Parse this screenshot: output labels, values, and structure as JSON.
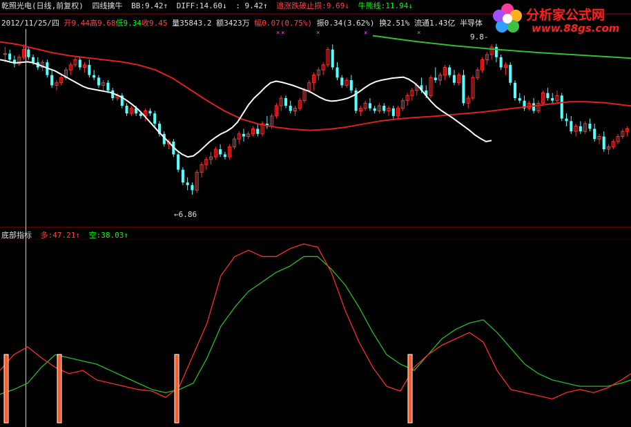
{
  "header": {
    "stock_name": "乾照光电",
    "period": "(日线,前复权)",
    "indicator_name": "四线擒牛",
    "bb_label": "BB:",
    "bb_value": "9.42↑",
    "diff_label": "DIFF:",
    "diff_value": "14.60↓",
    "colon_value": ": 9.42↑",
    "stop_label": "追涨跌破止损:",
    "stop_value": "9.69↓",
    "bull_label": "牛熊线:",
    "bull_value": "11.94↓"
  },
  "info": {
    "date": "2012/11/25/四",
    "open_label": "开",
    "open": "9.44",
    "high_label": "高",
    "high": "9.68",
    "low_label": "低",
    "low": "9.34",
    "close_label": "收",
    "close": "9.45",
    "volume_label": "量",
    "volume": "35843.2",
    "amount_label": "额",
    "amount": "3423万",
    "range_label": "幅",
    "range": "0.07(0.75%)",
    "amplitude_label": "振",
    "amplitude": "0.34(3.62%)",
    "turnover_label": "换",
    "turnover": "2.51%",
    "float_label": "流通",
    "float": "1.43亿",
    "sector": "半导体"
  },
  "indicator": {
    "name": "底部指标",
    "long_label": "多:",
    "long_value": "47.21↑",
    "short_label": "空:",
    "short_value": "38.03↑"
  },
  "logo": {
    "brand": "分析家公式网",
    "site": "www.88gs.com"
  },
  "annotations": {
    "high_label": "9.8-",
    "low_label": "6.86"
  },
  "colors": {
    "up": "#ff3232",
    "down": "#54ffff",
    "ma_white": "#ffffff",
    "ma_red": "#e02020",
    "bull_line": "#30c030",
    "ind_long": "#ff2a2a",
    "ind_short": "#20c020",
    "bottom_bar": "#ff5a28",
    "grid": "#a00000",
    "marker": "#ff40ff"
  },
  "chart_data": [
    {
      "type": "candlestick",
      "title": "乾照光电 (日线,前复权)",
      "ylim": [
        6.4,
        10.1
      ],
      "candles": [
        [
          9.6,
          9.75,
          9.45,
          9.62
        ],
        [
          9.62,
          9.7,
          9.45,
          9.5
        ],
        [
          9.5,
          9.58,
          9.35,
          9.42
        ],
        [
          9.42,
          9.6,
          9.38,
          9.55
        ],
        [
          9.55,
          9.8,
          9.5,
          9.7
        ],
        [
          9.7,
          9.75,
          9.5,
          9.55
        ],
        [
          9.55,
          9.6,
          9.4,
          9.45
        ],
        [
          9.45,
          9.55,
          9.3,
          9.35
        ],
        [
          9.35,
          9.5,
          9.28,
          9.45
        ],
        [
          9.45,
          9.5,
          9.15,
          9.2
        ],
        [
          9.2,
          9.3,
          8.95,
          9.0
        ],
        [
          9.0,
          9.1,
          8.9,
          9.05
        ],
        [
          9.05,
          9.2,
          9.0,
          9.15
        ],
        [
          9.15,
          9.35,
          9.1,
          9.3
        ],
        [
          9.3,
          9.45,
          9.2,
          9.4
        ],
        [
          9.4,
          9.55,
          9.35,
          9.5
        ],
        [
          9.5,
          9.55,
          9.3,
          9.35
        ],
        [
          9.35,
          9.45,
          9.25,
          9.4
        ],
        [
          9.4,
          9.5,
          9.15,
          9.2
        ],
        [
          9.2,
          9.3,
          9.1,
          9.15
        ],
        [
          9.15,
          9.2,
          8.95,
          9.0
        ],
        [
          9.0,
          9.1,
          8.9,
          9.05
        ],
        [
          9.05,
          9.1,
          8.85,
          8.9
        ],
        [
          8.9,
          8.95,
          8.7,
          8.75
        ],
        [
          8.75,
          8.85,
          8.7,
          8.8
        ],
        [
          8.8,
          8.85,
          8.55,
          8.6
        ],
        [
          8.6,
          8.65,
          8.4,
          8.45
        ],
        [
          8.45,
          8.6,
          8.4,
          8.55
        ],
        [
          8.55,
          8.6,
          8.4,
          8.45
        ],
        [
          8.45,
          8.5,
          8.35,
          8.4
        ],
        [
          8.4,
          8.55,
          8.3,
          8.5
        ],
        [
          8.5,
          8.55,
          8.4,
          8.45
        ],
        [
          8.45,
          8.5,
          8.2,
          8.25
        ],
        [
          8.25,
          8.3,
          8.0,
          8.05
        ],
        [
          8.05,
          8.1,
          7.8,
          7.85
        ],
        [
          7.85,
          7.95,
          7.75,
          7.9
        ],
        [
          7.9,
          7.95,
          7.6,
          7.65
        ],
        [
          7.65,
          7.7,
          7.3,
          7.35
        ],
        [
          7.35,
          7.4,
          7.05,
          7.1
        ],
        [
          7.1,
          7.2,
          6.95,
          7.05
        ],
        [
          7.05,
          7.1,
          6.86,
          6.95
        ],
        [
          6.95,
          7.35,
          6.9,
          7.3
        ],
        [
          7.3,
          7.5,
          7.2,
          7.45
        ],
        [
          7.45,
          7.6,
          7.35,
          7.55
        ],
        [
          7.55,
          7.7,
          7.45,
          7.6
        ],
        [
          7.6,
          7.8,
          7.55,
          7.75
        ],
        [
          7.75,
          7.85,
          7.6,
          7.65
        ],
        [
          7.65,
          7.7,
          7.55,
          7.6
        ],
        [
          7.6,
          7.85,
          7.55,
          7.8
        ],
        [
          7.8,
          8.0,
          7.75,
          7.95
        ],
        [
          7.95,
          8.1,
          7.85,
          8.05
        ],
        [
          8.05,
          8.15,
          7.9,
          8.0
        ],
        [
          8.0,
          8.1,
          7.95,
          8.05
        ],
        [
          8.05,
          8.2,
          8.0,
          8.15
        ],
        [
          8.15,
          8.25,
          8.0,
          8.05
        ],
        [
          8.05,
          8.3,
          8.0,
          8.25
        ],
        [
          8.25,
          8.4,
          8.15,
          8.2
        ],
        [
          8.2,
          8.45,
          8.15,
          8.4
        ],
        [
          8.4,
          8.65,
          8.35,
          8.6
        ],
        [
          8.6,
          8.8,
          8.5,
          8.75
        ],
        [
          8.75,
          8.8,
          8.55,
          8.6
        ],
        [
          8.6,
          8.7,
          8.45,
          8.5
        ],
        [
          8.5,
          8.6,
          8.4,
          8.55
        ],
        [
          8.55,
          8.75,
          8.5,
          8.7
        ],
        [
          8.7,
          8.95,
          8.65,
          8.9
        ],
        [
          8.9,
          9.1,
          8.85,
          9.05
        ],
        [
          9.05,
          9.25,
          8.9,
          9.2
        ],
        [
          9.2,
          9.35,
          9.1,
          9.3
        ],
        [
          9.3,
          9.45,
          9.2,
          9.4
        ],
        [
          9.4,
          9.75,
          9.35,
          9.7
        ],
        [
          9.7,
          9.8,
          9.3,
          9.35
        ],
        [
          9.35,
          9.45,
          9.1,
          9.15
        ],
        [
          9.15,
          9.2,
          8.95,
          9.0
        ],
        [
          9.0,
          9.15,
          8.95,
          9.1
        ],
        [
          9.1,
          9.2,
          8.85,
          8.9
        ],
        [
          8.9,
          8.95,
          8.45,
          8.5
        ],
        [
          8.5,
          8.6,
          8.4,
          8.55
        ],
        [
          8.55,
          8.7,
          8.5,
          8.65
        ],
        [
          8.65,
          8.75,
          8.5,
          8.55
        ],
        [
          8.55,
          8.6,
          8.45,
          8.5
        ],
        [
          8.5,
          8.65,
          8.45,
          8.6
        ],
        [
          8.6,
          8.65,
          8.45,
          8.5
        ],
        [
          8.5,
          8.6,
          8.4,
          8.55
        ],
        [
          8.55,
          8.6,
          8.35,
          8.4
        ],
        [
          8.4,
          8.6,
          8.35,
          8.55
        ],
        [
          8.55,
          8.75,
          8.5,
          8.7
        ],
        [
          8.7,
          8.85,
          8.6,
          8.8
        ],
        [
          8.8,
          8.95,
          8.7,
          8.9
        ],
        [
          8.9,
          9.05,
          8.8,
          9.0
        ],
        [
          9.0,
          9.15,
          8.85,
          8.9
        ],
        [
          8.9,
          9.0,
          8.75,
          8.8
        ],
        [
          8.8,
          9.2,
          8.75,
          9.15
        ],
        [
          9.15,
          9.35,
          9.05,
          9.1
        ],
        [
          9.1,
          9.25,
          9.0,
          9.2
        ],
        [
          9.2,
          9.4,
          9.1,
          9.35
        ],
        [
          9.35,
          9.4,
          9.15,
          9.2
        ],
        [
          9.2,
          9.3,
          9.0,
          9.05
        ],
        [
          9.05,
          9.25,
          9.0,
          9.2
        ],
        [
          9.2,
          9.3,
          8.6,
          8.65
        ],
        [
          8.65,
          8.8,
          8.55,
          8.75
        ],
        [
          8.75,
          9.2,
          8.7,
          9.15
        ],
        [
          9.15,
          9.35,
          9.1,
          9.3
        ],
        [
          9.3,
          9.55,
          9.25,
          9.5
        ],
        [
          9.5,
          9.65,
          9.4,
          9.6
        ],
        [
          9.6,
          9.8,
          9.5,
          9.75
        ],
        [
          9.75,
          9.81,
          9.45,
          9.55
        ],
        [
          9.55,
          9.6,
          9.3,
          9.35
        ],
        [
          9.35,
          9.45,
          9.2,
          9.4
        ],
        [
          9.4,
          9.45,
          9.0,
          9.05
        ],
        [
          9.05,
          9.1,
          8.7,
          8.75
        ],
        [
          8.75,
          8.85,
          8.65,
          8.7
        ],
        [
          8.7,
          8.8,
          8.5,
          8.55
        ],
        [
          8.55,
          8.7,
          8.5,
          8.65
        ],
        [
          8.65,
          8.75,
          8.45,
          8.5
        ],
        [
          8.5,
          8.7,
          8.45,
          8.65
        ],
        [
          8.65,
          8.9,
          8.6,
          8.85
        ],
        [
          8.85,
          8.95,
          8.7,
          8.75
        ],
        [
          8.75,
          8.85,
          8.65,
          8.7
        ],
        [
          8.7,
          8.9,
          8.65,
          8.8
        ],
        [
          8.8,
          8.85,
          8.3,
          8.35
        ],
        [
          8.35,
          8.45,
          8.2,
          8.3
        ],
        [
          8.3,
          8.4,
          8.05,
          8.1
        ],
        [
          8.1,
          8.25,
          8.0,
          8.2
        ],
        [
          8.2,
          8.3,
          8.05,
          8.1
        ],
        [
          8.1,
          8.3,
          8.05,
          8.25
        ],
        [
          8.25,
          8.35,
          8.1,
          8.15
        ],
        [
          8.15,
          8.25,
          7.9,
          7.95
        ],
        [
          7.95,
          8.05,
          7.85,
          8.0
        ],
        [
          8.0,
          8.1,
          7.7,
          7.75
        ],
        [
          7.75,
          7.85,
          7.65,
          7.8
        ],
        [
          7.8,
          7.95,
          7.75,
          7.9
        ],
        [
          7.9,
          8.05,
          7.85,
          8.0
        ],
        [
          8.0,
          8.15,
          7.95,
          8.1
        ],
        [
          8.1,
          8.2,
          8.0,
          8.15
        ]
      ],
      "ma_white": [
        9.5,
        9.48,
        9.45,
        9.44,
        9.45,
        9.46,
        9.44,
        9.4,
        9.36,
        9.32,
        9.28,
        9.22,
        9.16,
        9.1,
        9.04,
        8.98,
        8.94,
        8.92,
        8.9,
        8.88,
        8.86,
        8.82,
        8.77,
        8.7,
        8.62,
        8.53,
        8.42,
        8.3,
        8.18,
        8.06,
        7.95,
        7.84,
        7.73,
        7.65,
        7.6,
        7.62,
        7.7,
        7.8,
        7.9,
        7.98,
        8.05,
        8.1,
        8.17,
        8.28,
        8.45,
        8.62,
        8.75,
        8.85,
        8.96,
        9.05,
        9.08,
        9.06,
        9.03,
        9.0,
        8.96,
        8.92,
        8.88,
        8.82,
        8.76,
        8.71,
        8.69,
        8.7,
        8.72,
        8.75,
        8.8,
        8.87,
        8.95,
        9.02,
        9.07,
        9.1,
        9.12,
        9.14,
        9.15,
        9.16,
        9.12,
        9.05,
        8.95,
        8.82,
        8.69,
        8.58,
        8.5,
        8.43,
        8.36,
        8.28,
        8.2,
        8.12,
        8.03,
        7.96,
        7.9,
        7.92
      ],
      "ma_white_x": [
        0,
        8,
        16,
        24,
        32,
        40,
        48,
        56,
        64,
        72,
        80,
        88,
        96,
        104,
        112,
        120,
        128,
        136,
        144,
        152,
        160,
        168,
        176,
        184,
        192,
        200,
        208,
        216,
        224,
        232,
        240,
        248,
        256,
        264,
        272,
        280,
        288,
        296,
        304,
        312,
        320,
        328,
        336,
        344,
        352,
        360,
        368,
        376,
        384,
        392,
        400,
        408,
        416,
        424,
        432,
        440,
        448,
        456,
        464,
        472,
        480,
        488,
        496,
        504,
        512,
        520,
        528,
        536,
        544,
        552,
        560,
        568,
        576,
        584,
        592,
        600,
        608,
        616,
        624,
        632,
        640,
        648,
        656,
        664,
        672,
        680,
        688,
        696,
        704,
        712
      ],
      "ma_red": [
        9.85,
        9.8,
        9.72,
        9.64,
        9.58,
        9.54,
        9.5,
        9.46,
        9.4,
        9.3,
        9.14,
        8.92,
        8.7,
        8.5,
        8.34,
        8.24,
        8.18,
        8.14,
        8.12,
        8.14,
        8.18,
        8.24,
        8.3,
        8.34,
        8.37,
        8.39,
        8.42,
        8.45,
        8.48,
        8.52,
        8.56,
        8.6,
        8.64,
        8.68,
        8.68,
        8.66,
        8.62,
        8.58,
        8.55,
        8.53
      ],
      "ma_red_x": [
        0,
        25,
        50,
        75,
        100,
        125,
        150,
        175,
        200,
        225,
        250,
        275,
        300,
        325,
        350,
        375,
        400,
        425,
        450,
        475,
        500,
        525,
        550,
        575,
        600,
        625,
        650,
        675,
        700,
        725,
        750,
        775,
        800,
        825,
        850,
        875,
        900,
        925,
        950,
        1000
      ],
      "bull_line_x": [
        540,
        600,
        660,
        720,
        780,
        840,
        914
      ],
      "bull_line": [
        9.97,
        9.86,
        9.77,
        9.7,
        9.64,
        9.59,
        9.53
      ]
    },
    {
      "type": "line",
      "title": "底部指标",
      "ylim": [
        0,
        100
      ],
      "x": [
        0,
        20,
        40,
        60,
        80,
        100,
        120,
        140,
        160,
        180,
        200,
        220,
        240,
        260,
        280,
        300,
        320,
        340,
        360,
        380,
        400,
        420,
        440,
        460,
        480,
        500,
        520,
        540,
        560,
        580,
        600,
        620,
        640,
        660,
        680,
        700,
        720,
        740,
        760,
        780,
        800,
        820,
        840,
        860,
        880,
        900,
        914
      ],
      "series": [
        {
          "name": "多",
          "values": [
            20,
            30,
            35,
            28,
            22,
            18,
            20,
            14,
            12,
            10,
            8,
            7,
            3,
            10,
            30,
            50,
            80,
            92,
            96,
            92,
            92,
            97,
            100,
            98,
            82,
            58,
            38,
            22,
            10,
            7,
            22,
            30,
            36,
            40,
            44,
            38,
            20,
            8,
            6,
            4,
            2,
            6,
            8,
            6,
            9,
            14,
            18
          ]
        },
        {
          "name": "空",
          "values": [
            5,
            8,
            12,
            22,
            30,
            28,
            26,
            24,
            20,
            16,
            12,
            8,
            6,
            8,
            12,
            28,
            48,
            60,
            70,
            76,
            82,
            86,
            92,
            92,
            84,
            74,
            60,
            44,
            30,
            24,
            20,
            30,
            40,
            46,
            50,
            52,
            44,
            34,
            24,
            18,
            14,
            12,
            10,
            10,
            10,
            12,
            14
          ]
        }
      ]
    }
  ]
}
